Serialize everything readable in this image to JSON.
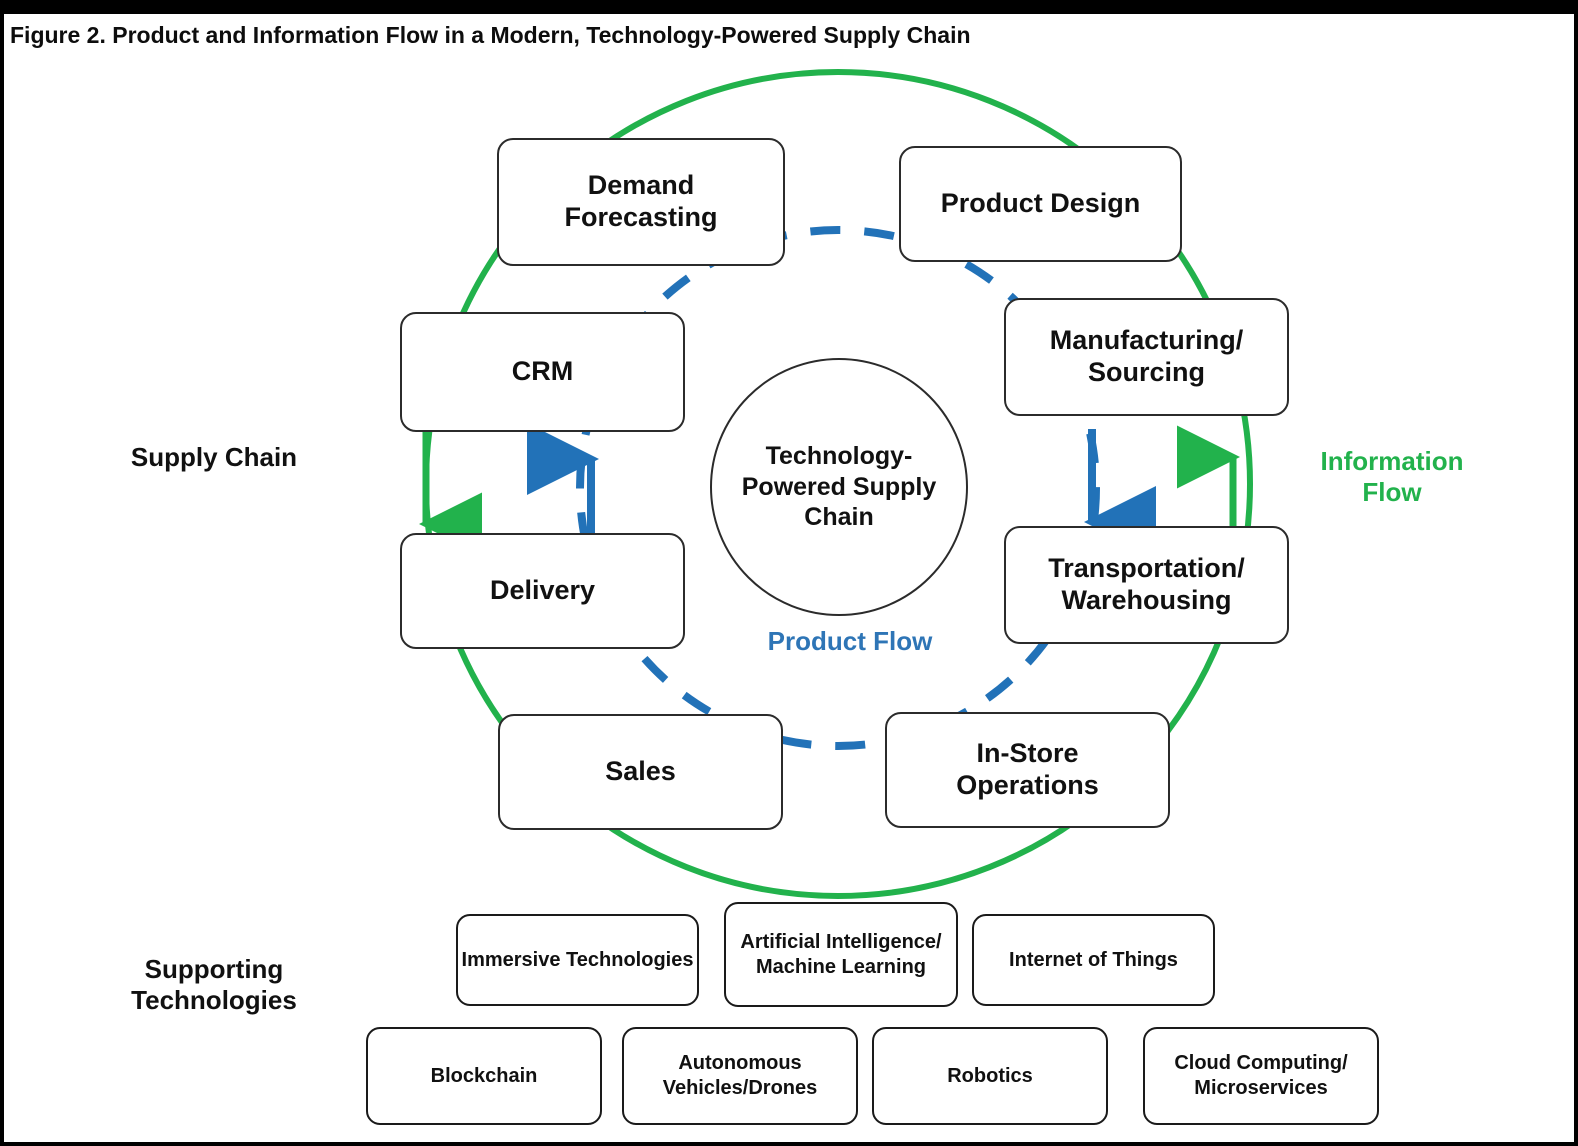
{
  "figure": {
    "title": "Figure 2. Product and Information Flow in a Modern, Technology-Powered Supply Chain"
  },
  "colors": {
    "information_flow": "#22B24C",
    "product_flow": "#2E75B6",
    "node_border": "#2b2b2b",
    "background": "#ffffff",
    "frame": "#000000"
  },
  "section_labels": {
    "supply_chain": "Supply\nChain",
    "supply_chain_line1": "Supply",
    "supply_chain_line2": "Chain",
    "supporting_technologies_line1": "Supporting",
    "supporting_technologies_line2": "Technologies"
  },
  "flow_legend": {
    "information_line1": "Information",
    "information_line2": "Flow",
    "product_line1": "Product",
    "product_line2": "Flow"
  },
  "center": {
    "line1": "Technology-",
    "line2": "Powered",
    "line3": "Supply",
    "line4": "Chain"
  },
  "nodes": [
    {
      "id": "demand-forecasting",
      "line1": "Demand",
      "line2": "Forecasting"
    },
    {
      "id": "product-design",
      "line1": "Product Design",
      "line2": ""
    },
    {
      "id": "manufacturing-sourcing",
      "line1": "Manufacturing/",
      "line2": "Sourcing"
    },
    {
      "id": "transportation-warehousing",
      "line1": "Transportation/",
      "line2": "Warehousing"
    },
    {
      "id": "in-store-operations",
      "line1": "In-Store",
      "line2": "Operations"
    },
    {
      "id": "sales",
      "line1": "Sales",
      "line2": ""
    },
    {
      "id": "delivery",
      "line1": "Delivery",
      "line2": ""
    },
    {
      "id": "crm",
      "line1": "CRM",
      "line2": ""
    }
  ],
  "supporting_technologies": {
    "row1": [
      {
        "id": "immersive-technologies",
        "line1": "Immersive",
        "line2": "Technologies",
        "line3": ""
      },
      {
        "id": "ai-ml",
        "line1": "Artificial",
        "line2": "Intelligence/",
        "line3": "Machine Learning"
      },
      {
        "id": "internet-of-things",
        "line1": "Internet of Things",
        "line2": "",
        "line3": ""
      }
    ],
    "row2": [
      {
        "id": "blockchain",
        "line1": "Blockchain",
        "line2": "",
        "line3": ""
      },
      {
        "id": "autonomous-vehicles",
        "line1": "Autonomous",
        "line2": "Vehicles/Drones",
        "line3": ""
      },
      {
        "id": "robotics",
        "line1": "Robotics",
        "line2": "",
        "line3": ""
      },
      {
        "id": "cloud-computing",
        "line1": "Cloud Computing/",
        "line2": "Microservices",
        "line3": ""
      }
    ]
  },
  "arrows": {
    "left_information_direction": "down",
    "left_product_direction": "up",
    "right_product_direction": "down",
    "right_information_direction": "up"
  }
}
